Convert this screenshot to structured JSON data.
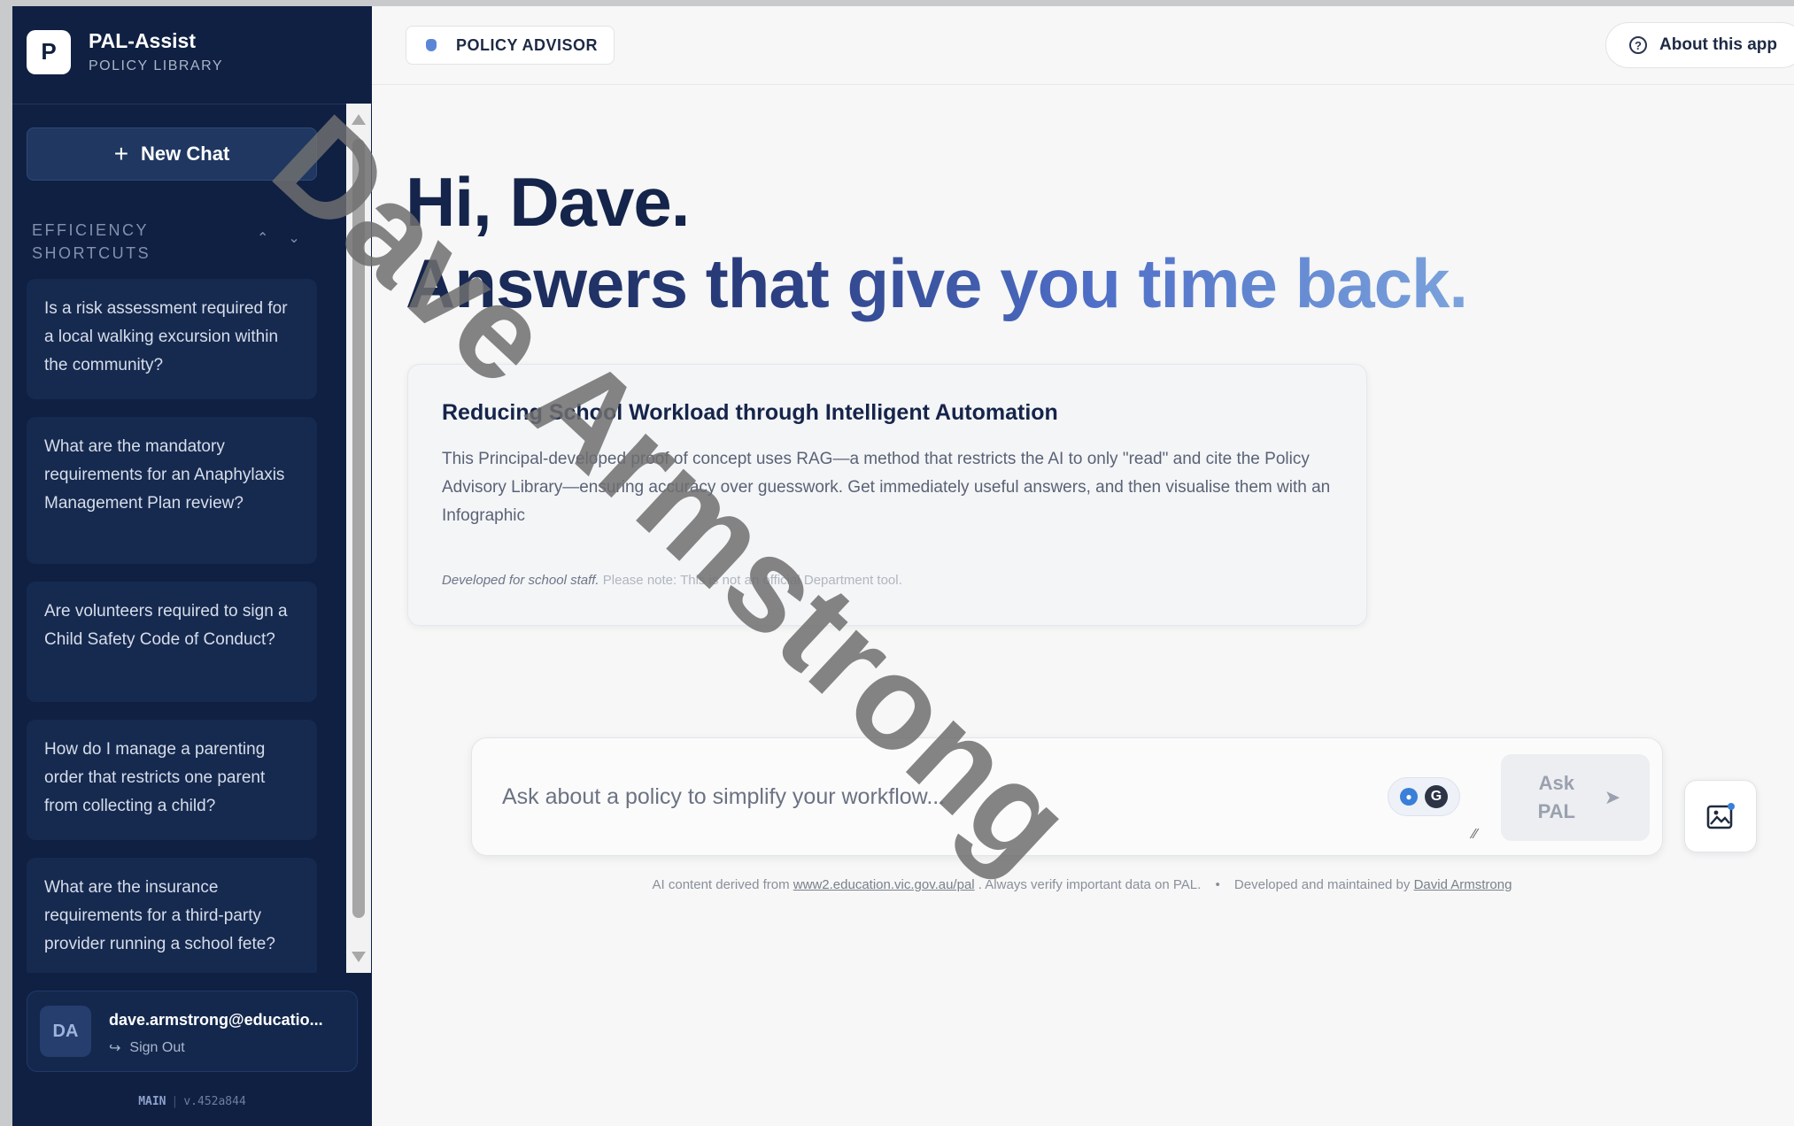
{
  "brand": {
    "logo_letter": "P",
    "name": "PAL-Assist",
    "subtitle": "POLICY LIBRARY"
  },
  "sidebar": {
    "new_chat_label": "New Chat",
    "shortcuts_title": "EFFICIENCY SHORTCUTS",
    "shortcuts": [
      "Is a risk assessment required for a local walking excursion within the community?",
      "What are the mandatory requirements for an Anaphylaxis Management Plan review?",
      "Are volunteers required to sign a Child Safety Code of Conduct?",
      "How do I manage a parenting order that restricts one parent from collecting a child?",
      "What are the insurance requirements for a third-party provider running a school fete?"
    ],
    "user": {
      "initials": "DA",
      "email": "dave.armstrong@educatio...",
      "signout_label": "Sign Out"
    },
    "version": {
      "branch": "MAIN",
      "sep": "|",
      "hash": "v.452a844"
    }
  },
  "header": {
    "mode_label": "POLICY ADVISOR",
    "about_label": "About this app"
  },
  "hero": {
    "greeting": "Hi, Dave.",
    "tagline": "Answers that give you time back."
  },
  "info_card": {
    "title": "Reducing School Workload through Intelligent Automation",
    "body": "This Principal-developed proof of concept uses RAG—a method that restricts the AI to only \"read\" and cite the Policy Advisory Library—ensuring accuracy over guesswork. Get immediately useful answers, and then visualise them with an Infographic",
    "foot_italic": "Developed for school staff.",
    "foot_note": "Please note: This is not an official Department tool."
  },
  "chat": {
    "placeholder": "Ask about a policy to simplify your workflow...",
    "ask_label": "Ask PAL"
  },
  "footer": {
    "prefix": "AI content derived from",
    "link": "www2.education.vic.gov.au/pal",
    "middle": ". Always verify important data on PAL.",
    "dev_prefix": "Developed and maintained by",
    "dev_name": "David Armstrong"
  },
  "watermark": "Dave Armstrong",
  "colors": {
    "sidebar_bg": "#0f2042",
    "card_bg": "#162a50",
    "heading": "#15244a",
    "accent": "#5b86d6"
  }
}
